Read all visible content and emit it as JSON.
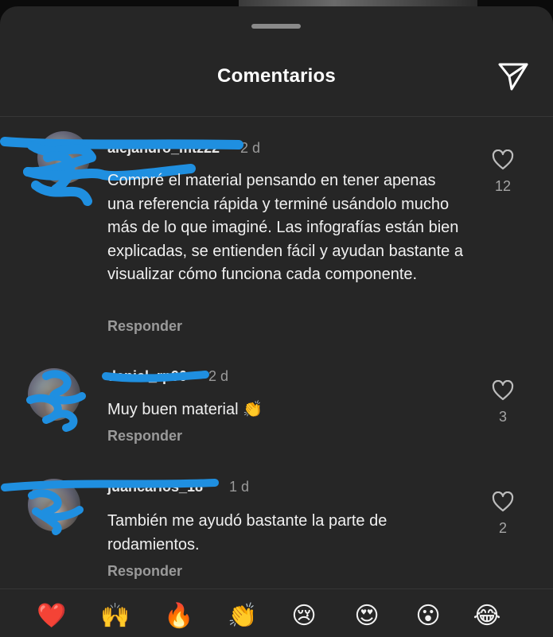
{
  "header": {
    "title": "Comentarios",
    "share_icon": "paper-plane-icon"
  },
  "comments": [
    {
      "username": "alejandro_mtz22",
      "time": "2 d",
      "text": "Compré el material pensando en tener apenas una referencia rápida y terminé usándolo mucho más de lo que imaginé. Las infografías están bien explicadas, se entienden fácil y ayudan bastante a visualizar cómo funciona cada componente.",
      "reply_label": "Responder",
      "likes": "12"
    },
    {
      "username": "daniel_rp90",
      "time": "2 d",
      "text": "Muy buen material 👏",
      "reply_label": "Responder",
      "likes": "3"
    },
    {
      "username": "juancarlos_18",
      "time": "1 d",
      "text": "También me ayudó bastante la parte de rodamientos.",
      "reply_label": "Responder",
      "likes": "2"
    }
  ],
  "reactions": [
    "❤️",
    "🙌",
    "🔥",
    "👏",
    "😢",
    "😍",
    "😮",
    "😂"
  ],
  "colors": {
    "sheet_bg": "#262626",
    "redaction": "#1f8fe0",
    "muted_text": "#9a9a9a"
  }
}
